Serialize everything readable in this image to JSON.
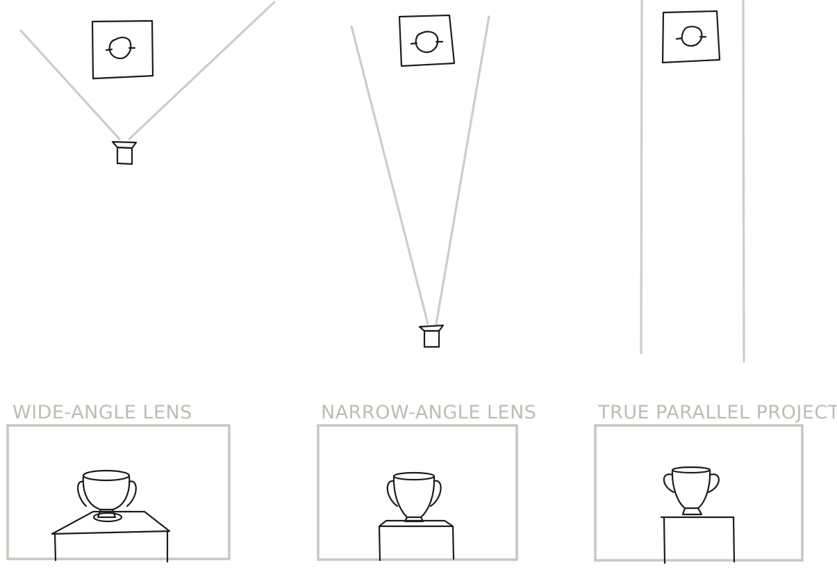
{
  "panels": [
    {
      "id": "wide",
      "caption": "WIDE-ANGLE LENS"
    },
    {
      "id": "narrow",
      "caption": "NARROW-ANGLE LENS"
    },
    {
      "id": "parallel",
      "caption": "TRUE PARALLEL PROJECTION"
    }
  ],
  "colors": {
    "ink": "#1b1b1b",
    "ray": "#cfccc5",
    "frame": "#c9c6be",
    "caption": "#bfbcb4",
    "background": "#ffffff"
  }
}
